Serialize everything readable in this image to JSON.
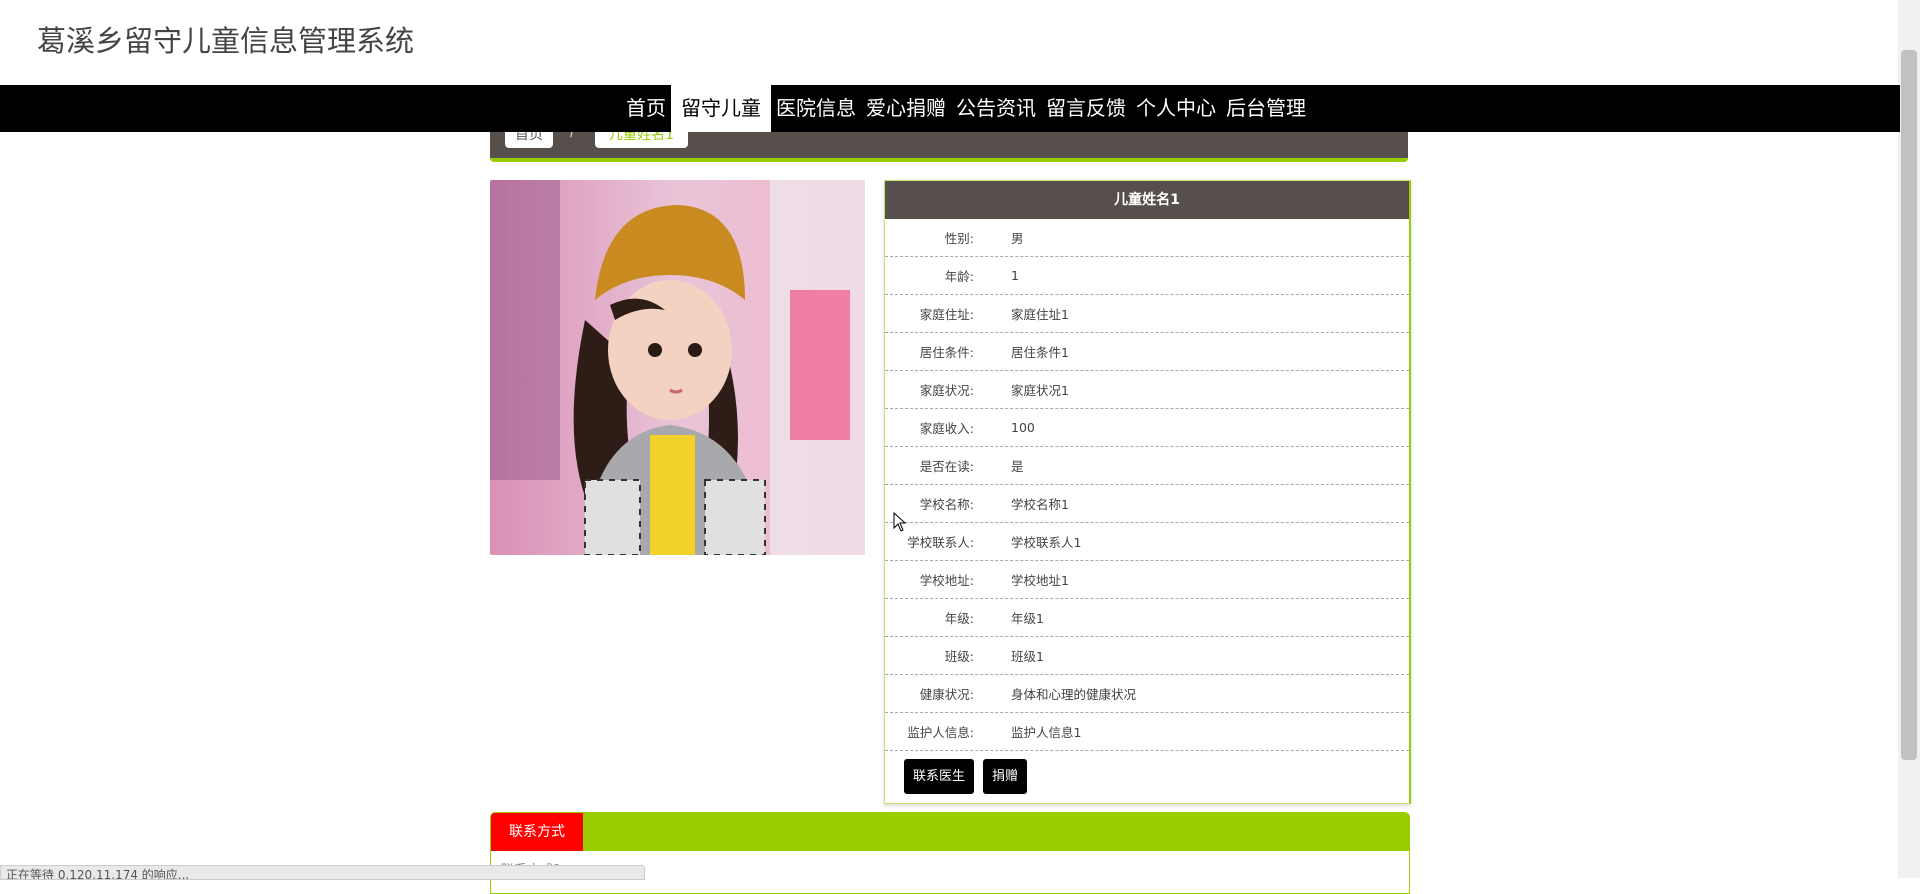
{
  "site": {
    "title": "葛溪乡留守儿童信息管理系统"
  },
  "nav": [
    {
      "label": "首页",
      "active": false
    },
    {
      "label": "留守儿童",
      "active": true
    },
    {
      "label": "医院信息",
      "active": false
    },
    {
      "label": "爱心捐赠",
      "active": false
    },
    {
      "label": "公告资讯",
      "active": false
    },
    {
      "label": "留言反馈",
      "active": false
    },
    {
      "label": "个人中心",
      "active": false
    },
    {
      "label": "后台管理",
      "active": false
    }
  ],
  "breadcrumb": {
    "home": "首页",
    "separator": "/",
    "current": "儿童姓名1"
  },
  "detail": {
    "title": "儿童姓名1",
    "fields": [
      {
        "label": "性别:",
        "value": "男"
      },
      {
        "label": "年龄:",
        "value": "1"
      },
      {
        "label": "家庭住址:",
        "value": "家庭住址1"
      },
      {
        "label": "居住条件:",
        "value": "居住条件1"
      },
      {
        "label": "家庭状况:",
        "value": "家庭状况1"
      },
      {
        "label": "家庭收入:",
        "value": "100"
      },
      {
        "label": "是否在读:",
        "value": "是"
      },
      {
        "label": "学校名称:",
        "value": "学校名称1"
      },
      {
        "label": "学校联系人:",
        "value": "学校联系人1"
      },
      {
        "label": "学校地址:",
        "value": "学校地址1"
      },
      {
        "label": "年级:",
        "value": "年级1"
      },
      {
        "label": "班级:",
        "value": "班级1"
      },
      {
        "label": "健康状况:",
        "value": "身体和心理的健康状况"
      },
      {
        "label": "监护人信息:",
        "value": "监护人信息1"
      }
    ],
    "buttons": {
      "contact_doctor": "联系医生",
      "donate": "捐赠"
    }
  },
  "contact": {
    "tab_label": "联系方式",
    "content": "联系方式1"
  },
  "status_bar": {
    "text": "正在等待 0.120.11.174 的响应..."
  },
  "colors": {
    "accent": "#9acd00",
    "header_dark": "#574f4c",
    "tab_red": "#ff0000",
    "nav_bg": "#000000"
  }
}
